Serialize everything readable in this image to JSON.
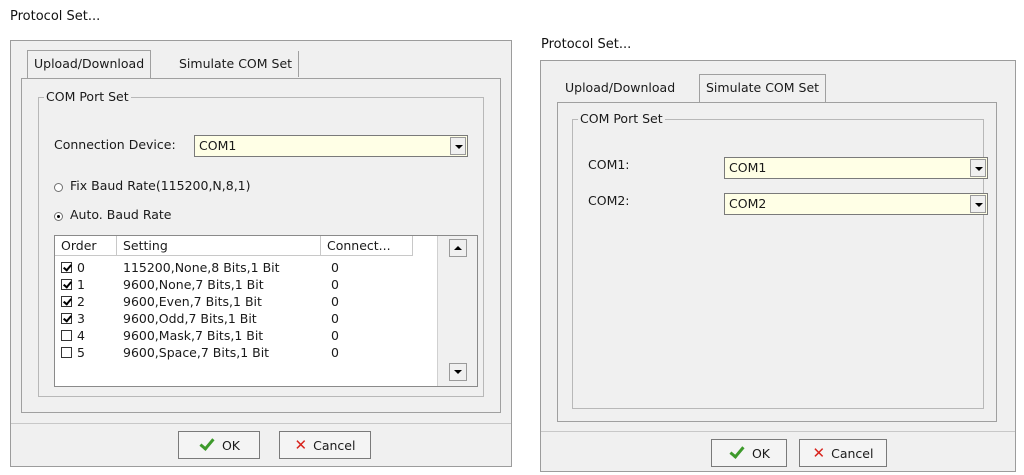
{
  "left": {
    "window_title": "Protocol Set...",
    "tabs": [
      {
        "label": "Upload/Download",
        "active": true
      },
      {
        "label": "Simulate COM Set",
        "active": false
      }
    ],
    "group_title": "COM Port Set",
    "connection_label": "Connection Device:",
    "connection_value": "COM1",
    "radio_fix": "Fix Baud Rate(115200,N,8,1)",
    "radio_auto": "Auto. Baud Rate",
    "radio_selected": "auto",
    "table": {
      "headers": [
        "Order",
        "Setting",
        "Connect..."
      ],
      "rows": [
        {
          "checked": true,
          "order": "0",
          "setting": "115200,None,8 Bits,1 Bit",
          "connect": "0"
        },
        {
          "checked": true,
          "order": "1",
          "setting": "9600,None,7 Bits,1 Bit",
          "connect": "0"
        },
        {
          "checked": true,
          "order": "2",
          "setting": "9600,Even,7 Bits,1 Bit",
          "connect": "0"
        },
        {
          "checked": true,
          "order": "3",
          "setting": "9600,Odd,7 Bits,1 Bit",
          "connect": "0"
        },
        {
          "checked": false,
          "order": "4",
          "setting": "9600,Mask,7 Bits,1 Bit",
          "connect": "0"
        },
        {
          "checked": false,
          "order": "5",
          "setting": "9600,Space,7 Bits,1 Bit",
          "connect": "0"
        }
      ]
    },
    "ok_label": "OK",
    "cancel_label": "Cancel"
  },
  "right": {
    "window_title": "Protocol Set...",
    "tabs": [
      {
        "label": "Upload/Download",
        "active": false
      },
      {
        "label": "Simulate COM Set",
        "active": true
      }
    ],
    "group_title": "COM Port Set",
    "com1_label": "COM1:",
    "com1_value": "COM1",
    "com2_label": "COM2:",
    "com2_value": "COM2",
    "ok_label": "OK",
    "cancel_label": "Cancel"
  },
  "colors": {
    "dialog_bg": "#f0f0f0",
    "combo_bg": "#ffffe6",
    "ok_icon": "#3d9a2b",
    "cancel_icon": "#d8241d"
  },
  "icons": {
    "ok": "check-icon",
    "cancel": "x-icon",
    "dropdown": "chevron-down-icon"
  }
}
